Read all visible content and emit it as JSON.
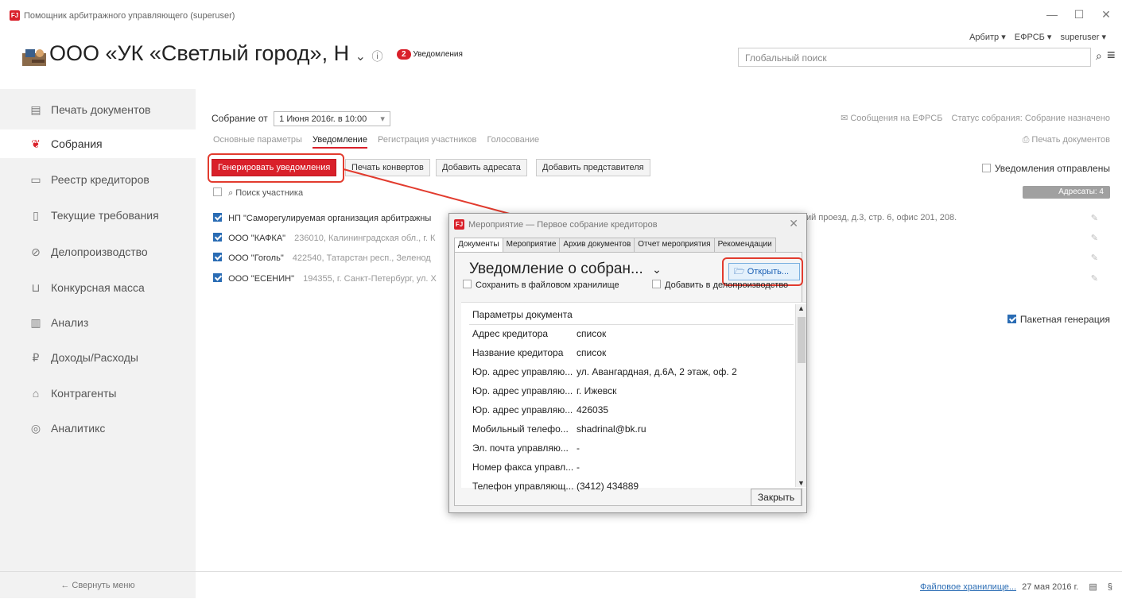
{
  "window": {
    "logo": "FJ",
    "title": "Помощник арбитражного управляющего (superuser)",
    "minimize": "—",
    "maximize": "☐",
    "close": "✕"
  },
  "header": {
    "menu": [
      "Арбитр ▾",
      "ЕФРСБ ▾",
      "superuser ▾"
    ],
    "org_name": "ООО «УК «Светлый город», Н",
    "org_chevron": "⌄",
    "info_icon": "ⓘ",
    "notif_count": "2",
    "notif_label": "Уведомления",
    "search_placeholder": "Глобальный поиск",
    "search_icon": "⌕",
    "menu_icon": "≡"
  },
  "sidebar": {
    "items": [
      {
        "icon": "▤",
        "label": "Печать документов"
      },
      {
        "icon": "❦",
        "label": "Собрания"
      },
      {
        "icon": "▭",
        "label": "Реестр кредиторов"
      },
      {
        "icon": "▯",
        "label": "Текущие требования"
      },
      {
        "icon": "⊘",
        "label": "Делопроизводство"
      },
      {
        "icon": "⊔",
        "label": "Конкурсная масса"
      },
      {
        "icon": "▥",
        "label": "Анализ"
      },
      {
        "icon": "₽",
        "label": "Доходы/Расходы"
      },
      {
        "icon": "⌂",
        "label": "Контрагенты"
      },
      {
        "icon": "◎",
        "label": "Аналитикс"
      }
    ],
    "collapse_label": "← Свернуть меню"
  },
  "main": {
    "meeting_label": "Собрание от",
    "meeting_value": "1 Июня 2016г. в 10:00",
    "messages_link": "✉ Сообщения на ЕФРСБ",
    "status_text": "Статус собрания: Собрание назначено",
    "tabs": [
      "Основные параметры",
      "Уведомление",
      "Регистрация участников",
      "Голосование"
    ],
    "print_link": "⎙ Печать документов",
    "buttons": [
      "Генерировать уведомления",
      "Печать конвертов",
      "Добавить адресата",
      "Добавить представителя"
    ],
    "notifications_sent": "Уведомления отправлены",
    "search_participant": "⌕ Поиск участника",
    "addressees": "Адресаты: 4",
    "batch_generation": "Пакетная генерация",
    "rows": [
      {
        "name": "НП \"Саморегулируемая организация арбитражны",
        "address": ""
      },
      {
        "name": "ООО \"КАФКА\"",
        "address": "236010, Калининградская обл., г. К"
      },
      {
        "name": "ООО \"Гоголь\"",
        "address": "422540, Татарстан респ., Зеленод"
      },
      {
        "name": "ООО \"ЕСЕНИН\"",
        "address": "194355, г. Санкт-Петербург, ул. Х"
      }
    ],
    "row0_tail": "ий проезд, д.3, стр. 6, офис 201, 208."
  },
  "footer": {
    "storage_link": "Файловое хранилище...",
    "date": "27 мая 2016 г.",
    "section": "§"
  },
  "dialog": {
    "title": "Мероприятие — Первое собрание кредиторов",
    "tabs": [
      "Документы",
      "Мероприятие",
      "Архив документов",
      "Отчет мероприятия",
      "Рекомендации"
    ],
    "doc_title": "Уведомление о собран...",
    "open_button": "Открыть...",
    "save_file": "Сохранить в файловом хранилище",
    "add_office": "Добавить в делопроизводство",
    "params_header": "Параметры документа",
    "params": [
      {
        "label": "Адрес кредитора",
        "value": "список"
      },
      {
        "label": "Название кредитора",
        "value": "список"
      },
      {
        "label": "Юр. адрес управляю...",
        "value": "ул. Авангардная, д.6А, 2 этаж, оф. 2"
      },
      {
        "label": "Юр. адрес управляю...",
        "value": "г. Ижевск"
      },
      {
        "label": "Юр. адрес управляю...",
        "value": "426035"
      },
      {
        "label": "Мобильный телефо...",
        "value": "shadrinal@bk.ru"
      },
      {
        "label": "Эл. почта управляю...",
        "value": "-"
      },
      {
        "label": "Номер факса управл...",
        "value": "-"
      },
      {
        "label": "Телефон управляющ...",
        "value": "(3412) 434889"
      }
    ],
    "close_button": "Закрыть"
  }
}
